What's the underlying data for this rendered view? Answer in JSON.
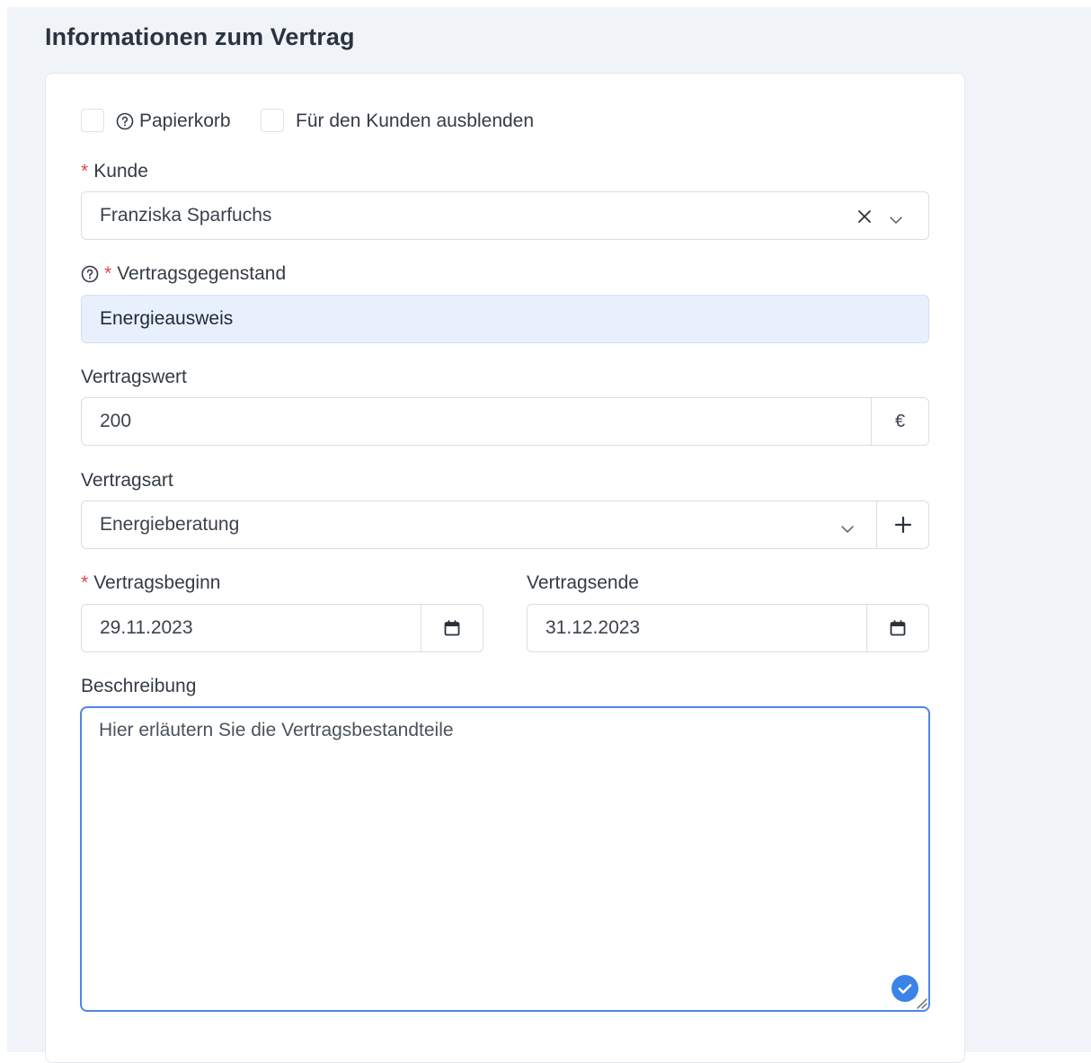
{
  "section": {
    "title": "Informationen zum Vertrag"
  },
  "checkboxes": {
    "trash_label": "Papierkorb",
    "hide_label": "Für den Kunden ausblenden"
  },
  "customer": {
    "label": "Kunde",
    "required_mark": "*",
    "value": "Franziska Sparfuchs"
  },
  "subject": {
    "label": "Vertragsgegenstand",
    "required_mark": "*",
    "value": "Energieausweis"
  },
  "contract_value": {
    "label": "Vertragswert",
    "value": "200",
    "currency": "€"
  },
  "contract_type": {
    "label": "Vertragsart",
    "value": "Energieberatung"
  },
  "start": {
    "label": "Vertragsbeginn",
    "required_mark": "*",
    "value": "29.11.2023"
  },
  "end": {
    "label": "Vertragsende",
    "value": "31.12.2023"
  },
  "description": {
    "label": "Beschreibung",
    "placeholder": "Hier erläutern Sie die Vertragsbestandteile"
  },
  "colors": {
    "accent": "#4f86e6",
    "required": "#e0454b",
    "filled_bg": "#e8f0fe",
    "page_bg": "#f0f4f8"
  },
  "icons": [
    "help-icon",
    "clear-icon",
    "chevron-down-icon",
    "plus-icon",
    "calendar-icon",
    "check-badge-icon",
    "resize-handle-icon"
  ]
}
